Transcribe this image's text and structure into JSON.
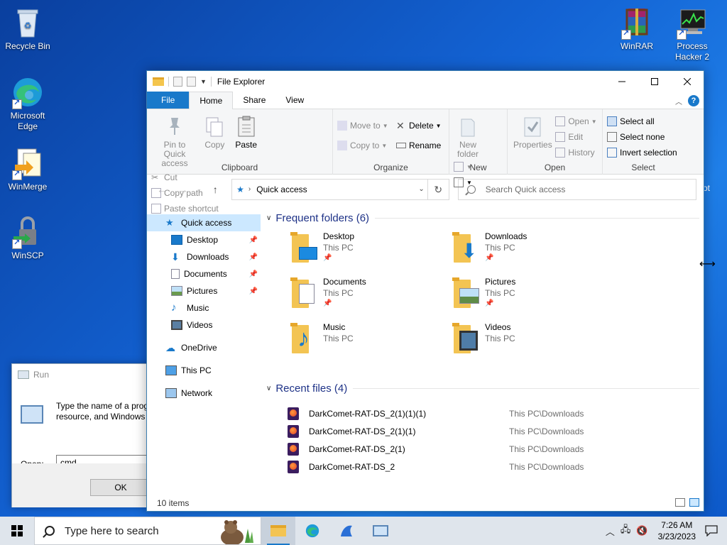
{
  "desktop": {
    "icons": [
      {
        "label": "Recycle Bin"
      },
      {
        "label": "Microsoft Edge"
      },
      {
        "label": "WinMerge"
      },
      {
        "label": "WinSCP"
      },
      {
        "label": "WinRAR"
      },
      {
        "label": "Process Hacker 2"
      }
    ],
    "offscreen_fragment": "ot"
  },
  "run_dialog": {
    "title": "Run",
    "description_line1": "Type the name of a prog",
    "description_line2": "resource, and Windows",
    "open_label": "Open:",
    "open_value": "cmd",
    "ok_label": "OK"
  },
  "explorer": {
    "title": "File Explorer",
    "tabs": [
      {
        "label": "File"
      },
      {
        "label": "Home"
      },
      {
        "label": "Share"
      },
      {
        "label": "View"
      }
    ],
    "ribbon": {
      "clipboard": {
        "label": "Clipboard",
        "pin_line1": "Pin to Quick",
        "pin_line2": "access",
        "copy": "Copy",
        "paste": "Paste",
        "cut": "Cut",
        "copy_path": "Copy path",
        "paste_shortcut": "Paste shortcut"
      },
      "organize": {
        "label": "Organize",
        "move_to": "Move to",
        "copy_to": "Copy to",
        "delete": "Delete",
        "rename": "Rename"
      },
      "new": {
        "label": "New",
        "new_folder_line1": "New",
        "new_folder_line2": "folder"
      },
      "open": {
        "label": "Open",
        "properties": "Properties",
        "open": "Open",
        "edit": "Edit",
        "history": "History"
      },
      "select": {
        "label": "Select",
        "select_all": "Select all",
        "select_none": "Select none",
        "invert_selection": "Invert selection"
      }
    },
    "address": {
      "path": "Quick access",
      "search_placeholder": "Search Quick access"
    },
    "nav": [
      {
        "label": "Quick access"
      },
      {
        "label": "Desktop"
      },
      {
        "label": "Downloads"
      },
      {
        "label": "Documents"
      },
      {
        "label": "Pictures"
      },
      {
        "label": "Music"
      },
      {
        "label": "Videos"
      },
      {
        "label": "OneDrive"
      },
      {
        "label": "This PC"
      },
      {
        "label": "Network"
      }
    ],
    "frequent_header": "Frequent folders (6)",
    "folders": [
      {
        "name": "Desktop",
        "location": "This PC"
      },
      {
        "name": "Downloads",
        "location": "This PC"
      },
      {
        "name": "Documents",
        "location": "This PC"
      },
      {
        "name": "Pictures",
        "location": "This PC"
      },
      {
        "name": "Music",
        "location": "This PC"
      },
      {
        "name": "Videos",
        "location": "This PC"
      }
    ],
    "recent_header": "Recent files (4)",
    "recent_files": [
      {
        "name": "DarkComet-RAT-DS_2(1)(1)(1)",
        "path": "This PC\\Downloads"
      },
      {
        "name": "DarkComet-RAT-DS_2(1)(1)",
        "path": "This PC\\Downloads"
      },
      {
        "name": "DarkComet-RAT-DS_2(1)",
        "path": "This PC\\Downloads"
      },
      {
        "name": "DarkComet-RAT-DS_2",
        "path": "This PC\\Downloads"
      }
    ],
    "status": "10 items"
  },
  "taskbar": {
    "search_placeholder": "Type here to search",
    "time": "7:26 AM",
    "date": "3/23/2023"
  },
  "colors": {
    "accent": "#1979ca",
    "desktop": "#1363d4",
    "section_header": "#1e3287"
  }
}
